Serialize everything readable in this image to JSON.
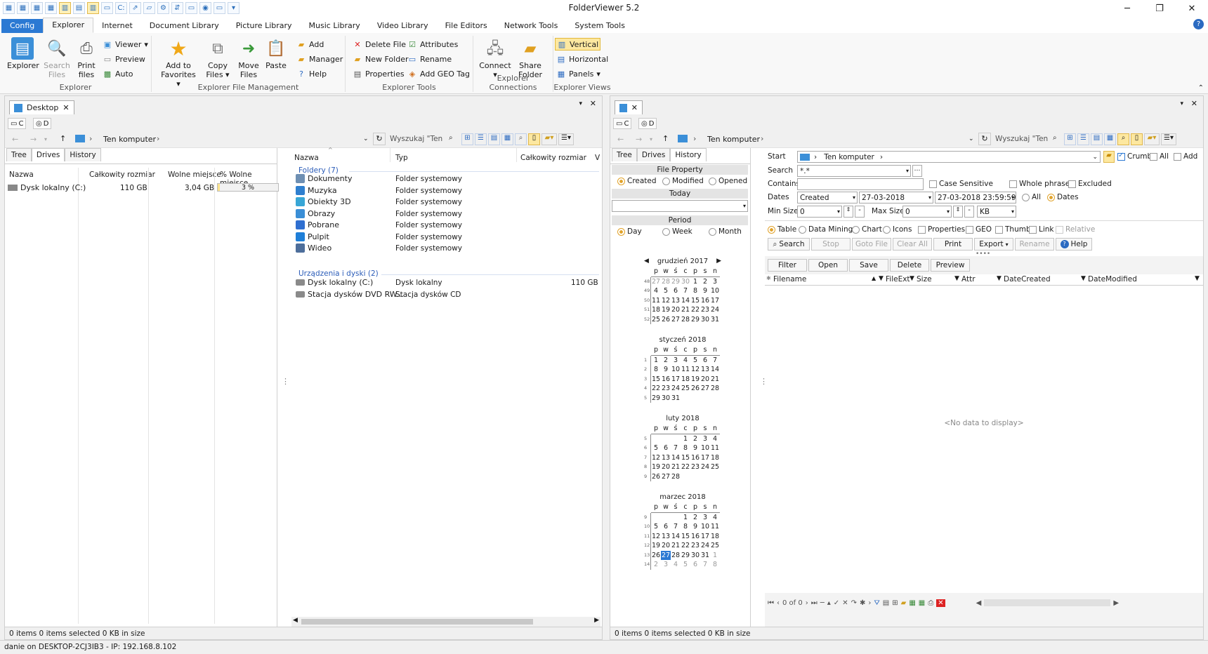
{
  "app": {
    "title": "FolderViewer 5.2"
  },
  "quick_access": [
    "▦",
    "▦",
    "▦",
    "▦",
    "▥",
    "▤",
    "▥",
    "▭",
    "C:",
    "⇗",
    "▱",
    "⚙",
    "⇵",
    "▭",
    "◉",
    "▭",
    "▾"
  ],
  "window": {
    "minimize": "─",
    "maximize": "❐",
    "close": "✕",
    "help": "?"
  },
  "ribbon_tabs": [
    "Config",
    "Explorer",
    "Internet",
    "Document Library",
    "Picture Library",
    "Music Library",
    "Video Library",
    "File Editors",
    "Network Tools",
    "System Tools"
  ],
  "ribbon": {
    "explorer": {
      "title": "Explorer",
      "explorer": "Explorer",
      "search": "Search",
      "files": "Files",
      "print": "Print",
      "print_files": "files",
      "viewer": "Viewer",
      "preview": "Preview",
      "auto": "Auto"
    },
    "file_mgmt": {
      "title": "Explorer File Management",
      "add_to": "Add to",
      "favorites": "Favorites",
      "copy": "Copy",
      "copy_files": "Files",
      "move": "Move",
      "move_files": "Files",
      "paste": "Paste",
      "add": "Add",
      "manager": "Manager",
      "help": "Help"
    },
    "tools": {
      "title": "Explorer Tools",
      "delete": "Delete File",
      "new_folder": "New Folder",
      "properties": "Properties",
      "attributes": "Attributes",
      "rename": "Rename",
      "geo": "Add GEO Tag"
    },
    "connections": {
      "title": "Explorer Connections",
      "connect": "Connect",
      "share": "Share",
      "share_folder": "Folder"
    },
    "views": {
      "title": "Explorer Views",
      "vertical": "Vertical",
      "horizontal": "Horizontal",
      "panels": "Panels"
    }
  },
  "left": {
    "tab": "Desktop",
    "drive_c": "C",
    "drive_d": "D",
    "breadcrumb": "Ten komputer",
    "search_placeholder": "Wyszukaj \"Ten",
    "subtabs": [
      "Tree",
      "Drives",
      "History"
    ],
    "drives_cols": [
      "Nazwa",
      "Całkowity rozmiar",
      "Wolne miejsce",
      "% Wolne miejsce"
    ],
    "drive_row": {
      "name": "Dysk lokalny (C:)",
      "size": "110 GB",
      "free": "3,04 GB",
      "pct_label": "3 %",
      "pct_value": 3
    },
    "list_cols": [
      "Nazwa",
      "Typ",
      "Całkowity rozmiar",
      "V"
    ],
    "group_folders": "Foldery (7)",
    "folders": [
      {
        "name": "Dokumenty",
        "type": "Folder systemowy",
        "color": "#6e8fb3"
      },
      {
        "name": "Muzyka",
        "type": "Folder systemowy",
        "color": "#2f7fcf"
      },
      {
        "name": "Obiekty 3D",
        "type": "Folder systemowy",
        "color": "#38a6d6"
      },
      {
        "name": "Obrazy",
        "type": "Folder systemowy",
        "color": "#3a8ed6"
      },
      {
        "name": "Pobrane",
        "type": "Folder systemowy",
        "color": "#2f6fd0"
      },
      {
        "name": "Pulpit",
        "type": "Folder systemowy",
        "color": "#1f7fd8"
      },
      {
        "name": "Wideo",
        "type": "Folder systemowy",
        "color": "#4d6e9b"
      }
    ],
    "group_devices": "Urządzenia i dyski (2)",
    "devices": [
      {
        "name": "Dysk lokalny (C:)",
        "type": "Dysk lokalny",
        "size": "110 GB"
      },
      {
        "name": "Stacja dysków DVD RW...",
        "type": "Stacja dysków CD",
        "size": ""
      }
    ],
    "status": "0 items  0 items selected 0 KB in size"
  },
  "right": {
    "drive_c": "C",
    "drive_d": "D",
    "breadcrumb": "Ten komputer",
    "search_placeholder": "Wyszukaj \"Ten",
    "subtabs": [
      "Tree",
      "Drives",
      "History"
    ],
    "file_property": "File Property",
    "fp_opts": [
      "Created",
      "Modified",
      "Opened"
    ],
    "today": "Today",
    "period": "Period",
    "period_opts": [
      "Day",
      "Week",
      "Month"
    ],
    "calendar": {
      "dow": [
        "p",
        "w",
        "ś",
        "c",
        "p",
        "s",
        "n"
      ],
      "months": [
        {
          "name": "grudzień 2017",
          "weeks": [
            {
              "wk": "48",
              "days": [
                "27",
                "28",
                "29",
                "30",
                "1",
                "2",
                "3"
              ],
              "dim": [
                0,
                1,
                2,
                3
              ]
            },
            {
              "wk": "49",
              "days": [
                "4",
                "5",
                "6",
                "7",
                "8",
                "9",
                "10"
              ],
              "dim": []
            },
            {
              "wk": "50",
              "days": [
                "11",
                "12",
                "13",
                "14",
                "15",
                "16",
                "17"
              ],
              "dim": []
            },
            {
              "wk": "51",
              "days": [
                "18",
                "19",
                "20",
                "21",
                "22",
                "23",
                "24"
              ],
              "dim": []
            },
            {
              "wk": "52",
              "days": [
                "25",
                "26",
                "27",
                "28",
                "29",
                "30",
                "31"
              ],
              "dim": []
            }
          ]
        },
        {
          "name": "styczeń 2018",
          "weeks": [
            {
              "wk": "1",
              "days": [
                "1",
                "2",
                "3",
                "4",
                "5",
                "6",
                "7"
              ],
              "dim": []
            },
            {
              "wk": "2",
              "days": [
                "8",
                "9",
                "10",
                "11",
                "12",
                "13",
                "14"
              ],
              "dim": []
            },
            {
              "wk": "3",
              "days": [
                "15",
                "16",
                "17",
                "18",
                "19",
                "20",
                "21"
              ],
              "dim": []
            },
            {
              "wk": "4",
              "days": [
                "22",
                "23",
                "24",
                "25",
                "26",
                "27",
                "28"
              ],
              "dim": []
            },
            {
              "wk": "5",
              "days": [
                "29",
                "30",
                "31",
                "",
                "",
                "",
                ""
              ],
              "dim": []
            }
          ]
        },
        {
          "name": "luty 2018",
          "weeks": [
            {
              "wk": "5",
              "days": [
                "",
                "",
                "",
                "1",
                "2",
                "3",
                "4"
              ],
              "dim": []
            },
            {
              "wk": "6",
              "days": [
                "5",
                "6",
                "7",
                "8",
                "9",
                "10",
                "11"
              ],
              "dim": []
            },
            {
              "wk": "7",
              "days": [
                "12",
                "13",
                "14",
                "15",
                "16",
                "17",
                "18"
              ],
              "dim": []
            },
            {
              "wk": "8",
              "days": [
                "19",
                "20",
                "21",
                "22",
                "23",
                "24",
                "25"
              ],
              "dim": []
            },
            {
              "wk": "9",
              "days": [
                "26",
                "27",
                "28",
                "",
                "",
                "",
                ""
              ],
              "dim": []
            }
          ]
        },
        {
          "name": "marzec 2018",
          "weeks": [
            {
              "wk": "9",
              "days": [
                "",
                "",
                "",
                "1",
                "2",
                "3",
                "4"
              ],
              "dim": []
            },
            {
              "wk": "10",
              "days": [
                "5",
                "6",
                "7",
                "8",
                "9",
                "10",
                "11"
              ],
              "dim": []
            },
            {
              "wk": "11",
              "days": [
                "12",
                "13",
                "14",
                "15",
                "16",
                "17",
                "18"
              ],
              "dim": []
            },
            {
              "wk": "12",
              "days": [
                "19",
                "20",
                "21",
                "22",
                "23",
                "24",
                "25"
              ],
              "dim": []
            },
            {
              "wk": "13",
              "days": [
                "26",
                "27",
                "28",
                "29",
                "30",
                "31",
                "1"
              ],
              "dim": [
                6
              ],
              "today": 1
            },
            {
              "wk": "14",
              "days": [
                "2",
                "3",
                "4",
                "5",
                "6",
                "7",
                "8"
              ],
              "dim": [
                0,
                1,
                2,
                3,
                4,
                5,
                6
              ]
            }
          ]
        }
      ]
    },
    "search": {
      "start_label": "Start",
      "start_value": "Ten komputer",
      "crumb": "Crumb",
      "all": "All",
      "add": "Add",
      "search_label": "Search",
      "search_value": "*.*",
      "contains_label": "Contains",
      "contains_value": "",
      "case": "Case Sensitive",
      "whole": "Whole phrase",
      "excluded": "Excluded",
      "dates_label": "Dates",
      "dates_field": "Created",
      "date_from": "27-03-2018",
      "date_to": "27-03-2018 23:59:59",
      "dates_all": "All",
      "dates_dates": "Dates",
      "minsize_label": "Min Size",
      "min_value": "0",
      "maxsize_label": "Max Size",
      "max_value": "0",
      "unit": "KB",
      "view_opts": [
        "Table",
        "Data Mining",
        "Chart",
        "Icons"
      ],
      "check_opts": [
        "Properties",
        "GEO",
        "Thumb",
        "Link",
        "Relative"
      ],
      "buttons": [
        "Search",
        "Stop",
        "Goto File",
        "Clear All",
        "Print",
        "Export",
        "Rename",
        "Help"
      ],
      "result_buttons": [
        "Filter",
        "Open",
        "Save",
        "Delete",
        "Preview"
      ],
      "result_cols": [
        "Filename",
        "FileExt",
        "Size",
        "Attr",
        "DateCreated",
        "DateModified"
      ],
      "no_data": "<No data to display>",
      "nav_count": "0 of 0"
    },
    "status": "0 items  0 items selected 0 KB in size"
  },
  "statusbar": "danie on DESKTOP-2CJ3IB3 - IP: 192.168.8.102"
}
